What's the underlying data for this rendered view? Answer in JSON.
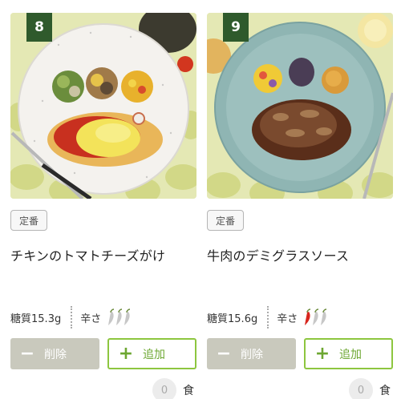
{
  "meals": [
    {
      "number": "8",
      "photo": "チキンのトマトチーズがけ 料理写真",
      "tag": "定番",
      "name": "チキンのトマトチーズがけ",
      "carb_label": "糖質",
      "carb_value": "15.3g",
      "spice_label": "辛さ",
      "spice_level": 0,
      "spice_max": 3,
      "remove_label": "削除",
      "add_label": "追加",
      "count": "0",
      "count_unit": "食"
    },
    {
      "number": "9",
      "photo": "牛肉のデミグラスソース 料理写真",
      "tag": "定番",
      "name": "牛肉のデミグラスソース",
      "carb_label": "糖質",
      "carb_value": "15.6g",
      "spice_label": "辛さ",
      "spice_level": 1,
      "spice_max": 3,
      "remove_label": "削除",
      "add_label": "追加",
      "count": "0",
      "count_unit": "食"
    }
  ],
  "colors": {
    "badge": "#2f5a2c",
    "add_border": "#8dc63f",
    "remove_bg": "#c9c9bd",
    "pepper_active": "#d7261e",
    "pepper_inactive": "#c7c7c7"
  },
  "icons": {
    "minus": "minus-icon",
    "plus": "plus-icon",
    "pepper": "chili-pepper-icon"
  }
}
